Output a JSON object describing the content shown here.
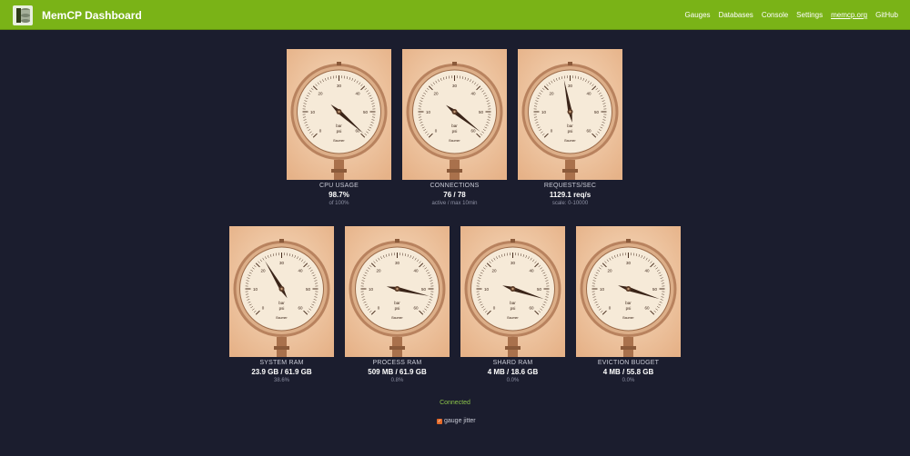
{
  "app": {
    "title": "MemCP Dashboard",
    "nav": [
      "Gauges",
      "Databases",
      "Console",
      "Settings",
      "memcp.org",
      "GitHub"
    ]
  },
  "gauges": [
    {
      "title": "CPU USAGE",
      "value": "98.7%",
      "sub": "of 100%",
      "needle_fraction": 0.987
    },
    {
      "title": "CONNECTIONS",
      "value": "76 / 78",
      "sub": "active / max 10min",
      "needle_fraction": 0.974
    },
    {
      "title": "REQUESTS/SEC",
      "value": "1129.1 req/s",
      "sub": "scale: 0-10000",
      "needle_fraction": 0.46
    },
    {
      "title": "SYSTEM RAM",
      "value": "23.9 GB / 61.9 GB",
      "sub": "38.6%",
      "needle_fraction": 0.386
    },
    {
      "title": "PROCESS RAM",
      "value": "509 MB / 61.9 GB",
      "sub": "0.8%",
      "needle_fraction": 0.88
    },
    {
      "title": "SHARD RAM",
      "value": "4 MB / 18.6 GB",
      "sub": "0.0%",
      "needle_fraction": 0.9
    },
    {
      "title": "EVICTION BUDGET",
      "value": "4 MB / 55.8 GB",
      "sub": "0.0%",
      "needle_fraction": 0.9
    }
  ],
  "dial": {
    "ticks": [
      "0",
      "10",
      "20",
      "30",
      "40",
      "50",
      "60"
    ],
    "units_top": "bar",
    "units_bottom": "psi",
    "maker": "Baumer"
  },
  "status": "Connected",
  "jitter": {
    "label": "gauge jitter",
    "checked": true,
    "check_glyph": "✓"
  },
  "colors": {
    "topbar": "#7ab317",
    "background": "#1b1d2e",
    "photo_bg": "#f2c8a0",
    "needle": "#3a2418",
    "rim": "#c7936a",
    "status": "#8bc34a",
    "checkbox": "#e56a28"
  }
}
